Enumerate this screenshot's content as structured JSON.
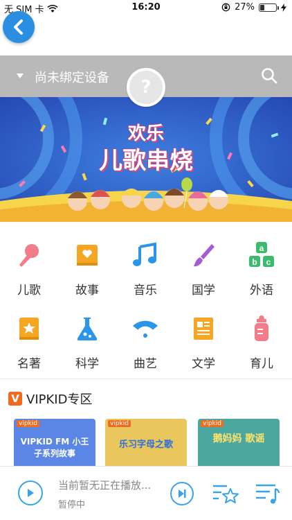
{
  "status_bar": {
    "carrier": "无 SIM 卡",
    "time": "16:20",
    "battery_percent": "27%",
    "battery_level": 0.27
  },
  "device": {
    "label": "尚未绑定设备",
    "badge": "?"
  },
  "banner": {
    "line1": "欢乐",
    "line2": "儿歌串烧"
  },
  "categories": [
    {
      "label": "儿歌",
      "icon": "microphone-icon",
      "color": "#f27c8a"
    },
    {
      "label": "故事",
      "icon": "book-heart-icon",
      "color": "#f5a623"
    },
    {
      "label": "音乐",
      "icon": "music-note-icon",
      "color": "#2b95e9"
    },
    {
      "label": "国学",
      "icon": "brush-icon",
      "color": "#a55bd4"
    },
    {
      "label": "外语",
      "icon": "abc-blocks-icon",
      "color": "#3dbb6c"
    },
    {
      "label": "名著",
      "icon": "star-book-icon",
      "color": "#f5a623"
    },
    {
      "label": "科学",
      "icon": "flask-icon",
      "color": "#2b95e9"
    },
    {
      "label": "曲艺",
      "icon": "fan-icon",
      "color": "#2b95e9"
    },
    {
      "label": "文学",
      "icon": "document-icon",
      "color": "#f5a623"
    },
    {
      "label": "育儿",
      "icon": "baby-bottle-icon",
      "color": "#f27c8a"
    }
  ],
  "vip": {
    "logo": "V",
    "title": "VIPKID专区",
    "cards": [
      {
        "tag": "vipkid",
        "title": "VIPKID FM 小王子系列故事",
        "bg": "#5b86e6"
      },
      {
        "tag": "vipkid",
        "title": "乐习字母之歌",
        "bg": "#e9c75c"
      },
      {
        "tag": "vipkid",
        "title": "鹅妈妈 歌谣",
        "bg": "#4aa8a0"
      }
    ]
  },
  "player": {
    "now_playing": "当前暂无正在播放...",
    "state": "暂停中"
  },
  "colors": {
    "accent": "#38a3e8",
    "back_button": "#2a8fe0",
    "device_bar": "#b9b9b9",
    "vip_orange": "#f26a1b"
  }
}
